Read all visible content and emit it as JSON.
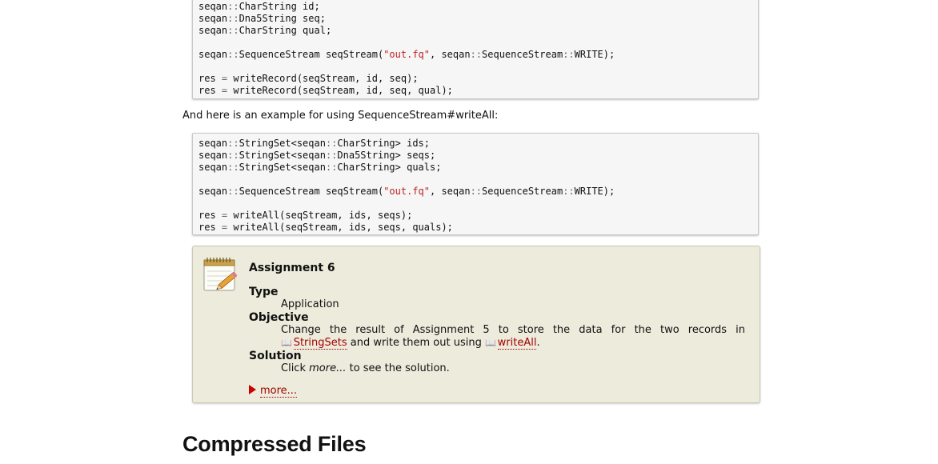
{
  "code_block_1": {
    "lines": [
      [
        {
          "t": "seqan"
        },
        {
          "t": "::",
          "op": true
        },
        {
          "t": "CharString id;"
        }
      ],
      [
        {
          "t": "seqan"
        },
        {
          "t": "::",
          "op": true
        },
        {
          "t": "Dna5String seq;"
        }
      ],
      [
        {
          "t": "seqan"
        },
        {
          "t": "::",
          "op": true
        },
        {
          "t": "CharString qual;"
        }
      ],
      [],
      [
        {
          "t": "seqan"
        },
        {
          "t": "::",
          "op": true
        },
        {
          "t": "SequenceStream seqStream("
        },
        {
          "t": "\"out.fq\"",
          "str": true
        },
        {
          "t": ", seqan"
        },
        {
          "t": "::",
          "op": true
        },
        {
          "t": "SequenceStream"
        },
        {
          "t": "::",
          "op": true
        },
        {
          "t": "WRITE);"
        }
      ],
      [],
      [
        {
          "t": "res "
        },
        {
          "t": "=",
          "op": true
        },
        {
          "t": " writeRecord(seqStream, id, seq);"
        }
      ],
      [
        {
          "t": "res "
        },
        {
          "t": "=",
          "op": true
        },
        {
          "t": " writeRecord(seqStream, id, seq, qual);"
        }
      ]
    ]
  },
  "intro_text": "And here is an example for using SequenceStream#writeAll:",
  "code_block_2": {
    "lines": [
      [
        {
          "t": "seqan"
        },
        {
          "t": "::",
          "op": true
        },
        {
          "t": "StringSet<seqan"
        },
        {
          "t": "::",
          "op": true
        },
        {
          "t": "CharString> ids;"
        }
      ],
      [
        {
          "t": "seqan"
        },
        {
          "t": "::",
          "op": true
        },
        {
          "t": "StringSet<seqan"
        },
        {
          "t": "::",
          "op": true
        },
        {
          "t": "Dna5String> seqs;"
        }
      ],
      [
        {
          "t": "seqan"
        },
        {
          "t": "::",
          "op": true
        },
        {
          "t": "StringSet<seqan"
        },
        {
          "t": "::",
          "op": true
        },
        {
          "t": "CharString> quals;"
        }
      ],
      [],
      [
        {
          "t": "seqan"
        },
        {
          "t": "::",
          "op": true
        },
        {
          "t": "SequenceStream seqStream("
        },
        {
          "t": "\"out.fq\"",
          "str": true
        },
        {
          "t": ", seqan"
        },
        {
          "t": "::",
          "op": true
        },
        {
          "t": "SequenceStream"
        },
        {
          "t": "::",
          "op": true
        },
        {
          "t": "WRITE);"
        }
      ],
      [],
      [
        {
          "t": "res "
        },
        {
          "t": "=",
          "op": true
        },
        {
          "t": " writeAll(seqStream, ids, seqs);"
        }
      ],
      [
        {
          "t": "res "
        },
        {
          "t": "=",
          "op": true
        },
        {
          "t": " writeAll(seqStream, ids, seqs, quals);"
        }
      ]
    ]
  },
  "assignment": {
    "title": "Assignment 6",
    "type_label": "Type",
    "type_value": "Application",
    "objective_label": "Objective",
    "objective_line1": "Change the result of Assignment 5 to store the data for the two records in",
    "objective_link1": "StringSets",
    "objective_mid": " and write them out using ",
    "objective_link2": "writeAll",
    "objective_end": ".",
    "solution_label": "Solution",
    "solution_pre": "Click ",
    "solution_em": "more...",
    "solution_post": " to see the solution.",
    "more_label": "more...",
    "icon": "notepad-pencil-icon",
    "link_icon": "book-icon"
  },
  "section_heading": "Compressed Files",
  "colors": {
    "link": "#a40000",
    "string_literal": "#b22222",
    "assignment_bg": "#ecebdc"
  }
}
